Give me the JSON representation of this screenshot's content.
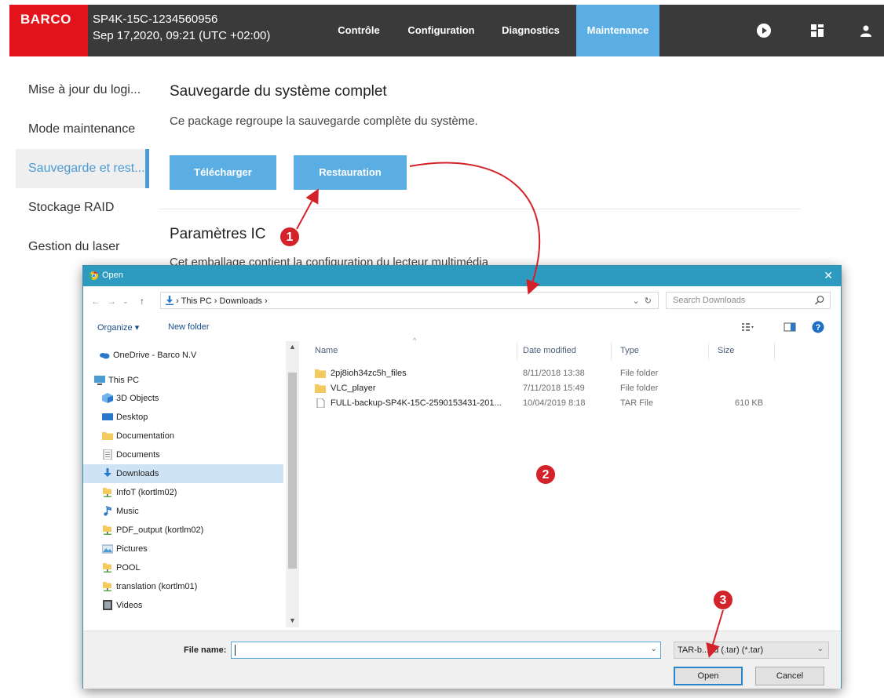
{
  "app": {
    "logo": "BARCO",
    "device_name": "SP4K-15C-1234560956",
    "datetime": "Sep 17,2020, 09:21 (UTC +02:00)",
    "tabs": [
      {
        "label": "Contrôle"
      },
      {
        "label": "Configuration"
      },
      {
        "label": "Diagnostics"
      },
      {
        "label": "Maintenance",
        "active": true
      }
    ],
    "icons": [
      "play-icon",
      "grid-icon",
      "user-icon"
    ],
    "accent_color": "#5aaee4",
    "brand_color": "#e3131b"
  },
  "sidebar": {
    "items": [
      {
        "label": "Mise à jour du logi..."
      },
      {
        "label": "Mode maintenance"
      },
      {
        "label": "Sauvegarde et rest...",
        "active": true
      },
      {
        "label": "Stockage RAID"
      },
      {
        "label": "Gestion du laser"
      }
    ]
  },
  "main": {
    "title": "Sauvegarde du système complet",
    "description": "Ce package regroupe la sauvegarde complète du système.",
    "download_button": "Télécharger",
    "restore_button": "Restauration",
    "section2_title": "Paramètres IC",
    "section2_description": "Cet emballage contient la configuration du lecteur multimédia"
  },
  "dialog": {
    "title": "Open",
    "address": {
      "this_pc": "This PC",
      "downloads": "Downloads",
      "sep": "›"
    },
    "search_placeholder": "Search Downloads",
    "toolbar": {
      "organize": "Organize ▾",
      "new_folder": "New folder"
    },
    "tree": [
      {
        "label": "OneDrive - Barco N.V",
        "icon": "onedrive-icon"
      },
      {
        "label": "This PC",
        "icon": "computer-icon"
      },
      {
        "label": "3D Objects",
        "icon": "cube-icon"
      },
      {
        "label": "Desktop",
        "icon": "desktop-icon"
      },
      {
        "label": "Documentation",
        "icon": "folder-icon"
      },
      {
        "label": "Documents",
        "icon": "document-icon"
      },
      {
        "label": "Downloads",
        "icon": "download-icon",
        "selected": true
      },
      {
        "label": "InfoT (kortlm02)",
        "icon": "network-folder-icon"
      },
      {
        "label": "Music",
        "icon": "music-icon"
      },
      {
        "label": "PDF_output (kortlm02)",
        "icon": "network-folder-icon"
      },
      {
        "label": "Pictures",
        "icon": "pictures-icon"
      },
      {
        "label": "POOL",
        "icon": "network-folder-icon"
      },
      {
        "label": "translation (kortlm01)",
        "icon": "network-folder-icon"
      },
      {
        "label": "Videos",
        "icon": "video-icon"
      }
    ],
    "columns": [
      "Name",
      "Date modified",
      "Type",
      "Size"
    ],
    "files": [
      {
        "name": "2pj8ioh34zc5h_files",
        "date": "8/11/2018 13:38",
        "type": "File folder",
        "size": "",
        "icon": "folder-icon"
      },
      {
        "name": "VLC_player",
        "date": "7/11/2018 15:49",
        "type": "File folder",
        "size": "",
        "icon": "folder-icon"
      },
      {
        "name": "FULL-backup-SP4K-15C-2590153431-201...",
        "date": "10/04/2019 8:18",
        "type": "TAR File",
        "size": "610 KB",
        "icon": "file-icon"
      }
    ],
    "file_name_label": "File name:",
    "file_name_value": "",
    "file_type": "TAR-b...nd (.tar) (*.tar)",
    "open_button": "Open",
    "cancel_button": "Cancel"
  },
  "annotations": [
    "1",
    "2",
    "3"
  ],
  "annotation_color": "#d3222a"
}
